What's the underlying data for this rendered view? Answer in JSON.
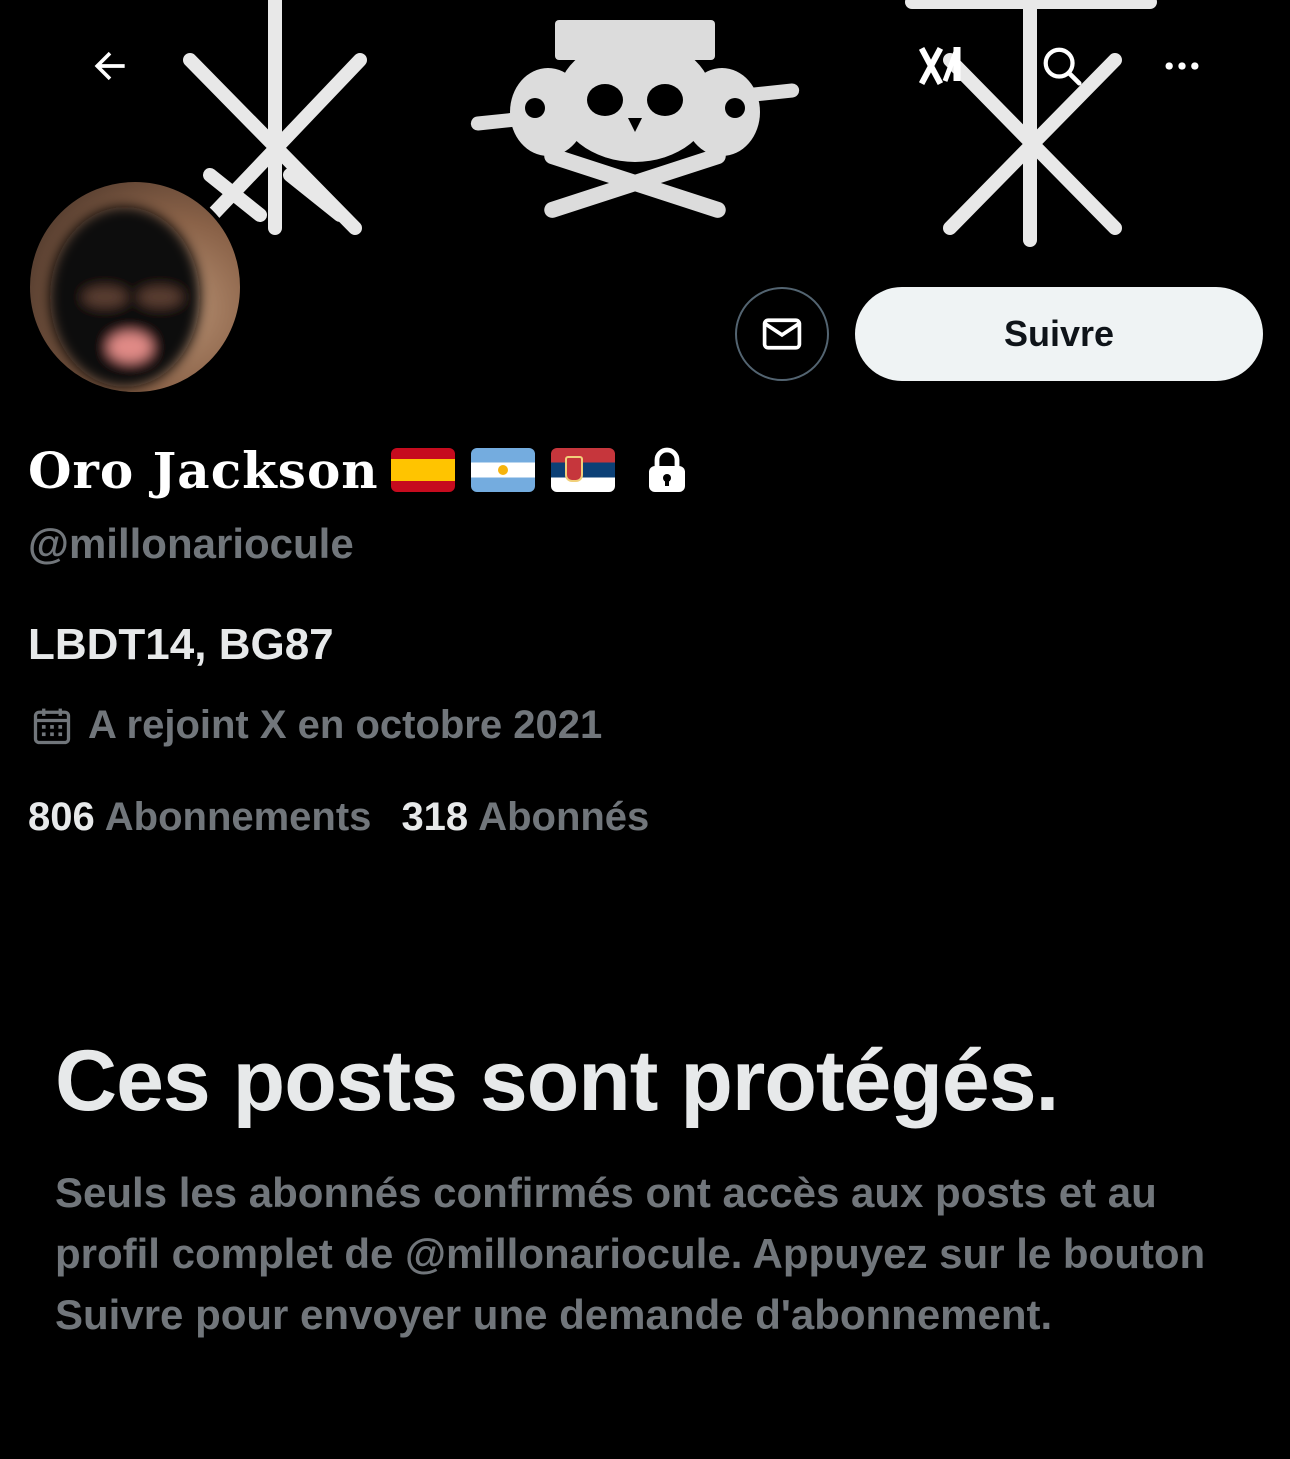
{
  "header": {
    "back_icon": "arrow-left-icon",
    "grok_icon": "xai-logo-icon",
    "search_icon": "search-icon",
    "more_icon": "more-horizontal-icon"
  },
  "profile": {
    "display_name": "Oro Jackson",
    "flags": [
      "spain-flag",
      "argentina-flag",
      "serbia-flag"
    ],
    "protected_icon": "lock-icon",
    "handle": "@millonariocule",
    "bio": "LBDT14, BG87",
    "joined_text": "A rejoint X en octobre 2021",
    "following_count": "806",
    "following_label": "Abonnements",
    "followers_count": "318",
    "followers_label": "Abonnés"
  },
  "actions": {
    "message_icon": "envelope-icon",
    "follow_label": "Suivre"
  },
  "protected": {
    "title": "Ces posts sont protégés.",
    "body": "Seuls les abonnés confirmés ont accès aux posts et au profil complet de @millonariocule. Appuyez sur le bouton Suivre pour envoyer une demande d'abonnement."
  },
  "colors": {
    "background": "#000000",
    "primary_text": "#e7e9ea",
    "secondary_text": "#71767b",
    "follow_button_bg": "#eff3f4"
  }
}
